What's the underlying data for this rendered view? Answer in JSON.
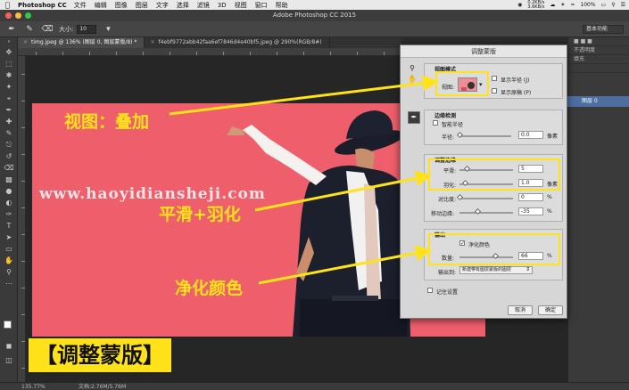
{
  "menubar": {
    "app": "Photoshop CC",
    "items": [
      "文件",
      "编辑",
      "图像",
      "图层",
      "文字",
      "选择",
      "滤镜",
      "3D",
      "视图",
      "窗口",
      "帮助"
    ],
    "net_up": "0.2KB/s",
    "net_down": "3.6KB/s",
    "battery": "100%"
  },
  "window": {
    "title": "Adobe Photoshop CC 2015"
  },
  "options_bar": {
    "size_label": "大小:",
    "size_value": "10",
    "workspace": "基本功能"
  },
  "tabs": [
    {
      "label": "timg.jpeg @ 136% (图层 0, 图层蒙版/8) *"
    },
    {
      "label": "f4ebf9772abb42faa6ef7846d4e40bf5.jpeg @ 290%(RGB/8#)"
    }
  ],
  "status": {
    "zoom": "135.77%",
    "doc": "文档:2.76M/5.76M"
  },
  "right_panel": {
    "opacity_label": "不透明度",
    "fill_label": "填充",
    "layer_name": "图层 0"
  },
  "colors": {
    "highlight": "#ffe21a",
    "pink": "#ee5f6b"
  },
  "dialog": {
    "title": "调整蒙版",
    "view_mode": {
      "title": "视图模式",
      "view_label": "视图:",
      "show_radius": "显示半径 (J)",
      "show_original": "显示原稿 (P)"
    },
    "edge_detection": {
      "title": "边缘检测",
      "smart_radius": "智能半径",
      "radius_label": "半径:",
      "radius_value": "0.0",
      "radius_unit": "像素"
    },
    "adjust_edge": {
      "title": "调整边缘",
      "smooth_label": "平滑:",
      "smooth_value": "5",
      "feather_label": "羽化:",
      "feather_value": "1.0",
      "feather_unit": "像素",
      "contrast_label": "对比度:",
      "contrast_value": "0",
      "contrast_unit": "%",
      "shift_label": "移动边缘:",
      "shift_value": "-35",
      "shift_unit": "%"
    },
    "output": {
      "title": "输出",
      "decontaminate": "净化颜色",
      "amount_label": "数量:",
      "amount_value": "66",
      "amount_unit": "%",
      "output_to_label": "输出到:",
      "output_to_value": "新建带有图层蒙版的图层"
    },
    "remember": "记住设置",
    "cancel": "取消",
    "ok": "确定"
  },
  "annotations": {
    "view_overlay": "视图：叠加",
    "smooth_feather": "平滑+羽化",
    "decontaminate": "净化颜色",
    "badge": "【调整蒙版】",
    "watermark": "www.haoyidiansheji.com"
  }
}
